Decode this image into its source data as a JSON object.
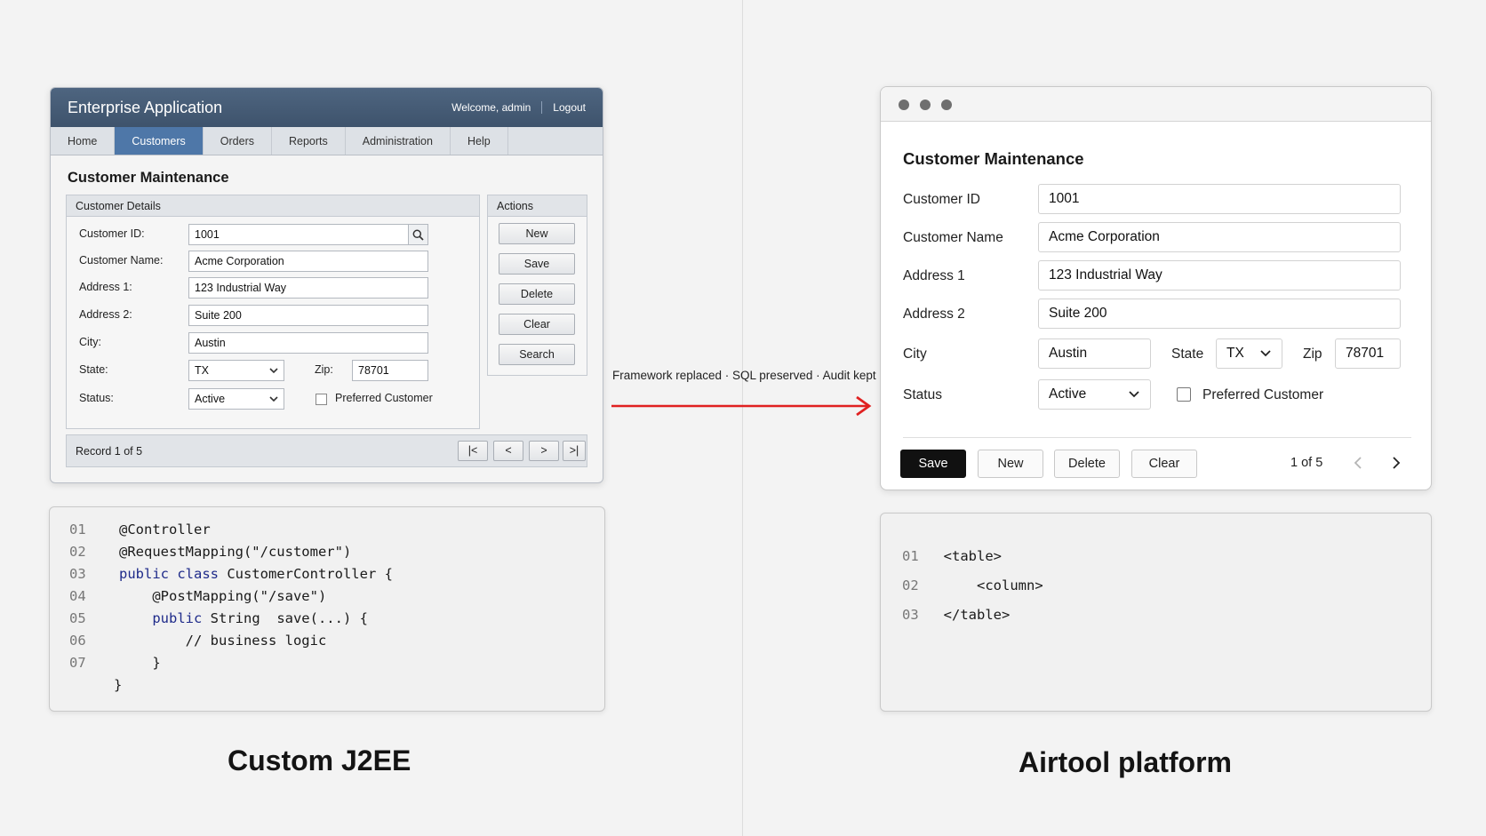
{
  "legacy": {
    "app_title": "Enterprise Application",
    "welcome": "Welcome, admin",
    "logout": "Logout",
    "tabs": [
      {
        "label": "Home",
        "active": false
      },
      {
        "label": "Customers",
        "active": true
      },
      {
        "label": "Orders",
        "active": false
      },
      {
        "label": "Reports",
        "active": false
      },
      {
        "label": "Administration",
        "active": false
      },
      {
        "label": "Help",
        "active": false
      }
    ],
    "page_title": "Customer Maintenance",
    "details_legend": "Customer Details",
    "fields": {
      "customer_id_label": "Customer ID:",
      "customer_id": "1001",
      "customer_name_label": "Customer Name:",
      "customer_name": "Acme Corporation",
      "address1_label": "Address 1:",
      "address1": "123 Industrial Way",
      "address2_label": "Address 2:",
      "address2": "Suite 200",
      "city_label": "City:",
      "city": "Austin",
      "state_label": "State:",
      "state": "TX",
      "zip_label": "Zip:",
      "zip": "78701",
      "status_label": "Status:",
      "status": "Active",
      "preferred_label": "Preferred Customer"
    },
    "actions_legend": "Actions",
    "actions": {
      "new": "New",
      "save": "Save",
      "delete": "Delete",
      "clear": "Clear",
      "search": "Search"
    },
    "record_text": "Record 1 of 5",
    "pager": {
      "first": "|<",
      "prev": "<",
      "next": ">",
      "last": ">|"
    }
  },
  "legacy_code": {
    "lines": [
      {
        "num": "01",
        "text": "@Controller"
      },
      {
        "num": "02",
        "text": "@RequestMapping(\"/customer\")"
      },
      {
        "num": "03",
        "kw": "public class",
        "rest": " CustomerController {"
      },
      {
        "num": "04",
        "text": "    @PostMapping(\"/save\")"
      },
      {
        "num": "05",
        "kw": "    public",
        "rest": " String  save(...) {"
      },
      {
        "num": "06",
        "text": "        // business logic"
      },
      {
        "num": "07",
        "text": "    }"
      }
    ],
    "closing": "}"
  },
  "arrow_label": "Framework replaced · SQL preserved · Audit kept",
  "modern": {
    "page_title": "Customer Maintenance",
    "customer_id_label": "Customer ID",
    "customer_id": "1001",
    "customer_name_label": "Customer Name",
    "customer_name": "Acme Corporation",
    "address1_label": "Address 1",
    "address1": "123 Industrial Way",
    "address2_label": "Address 2",
    "address2": "Suite 200",
    "city_label": "City",
    "city": "Austin",
    "state_label": "State",
    "state": "TX",
    "zip_label": "Zip",
    "zip": "78701",
    "status_label": "Status",
    "status": "Active",
    "preferred_label": "Preferred Customer",
    "buttons": {
      "save": "Save",
      "new": "New",
      "delete": "Delete",
      "clear": "Clear"
    },
    "pager_text": "1 of 5"
  },
  "modern_code": {
    "lines": [
      {
        "num": "01",
        "text": "<table>"
      },
      {
        "num": "02",
        "text": "    <column>"
      },
      {
        "num": "03",
        "text": "</table>"
      }
    ]
  },
  "captions": {
    "left": "Custom J2EE",
    "right": "Airtool platform"
  },
  "colors": {
    "legacy_header": "#465d77",
    "legacy_active_tab": "#4e77a8",
    "arrow": "#e02020",
    "primary_button": "#111111"
  }
}
